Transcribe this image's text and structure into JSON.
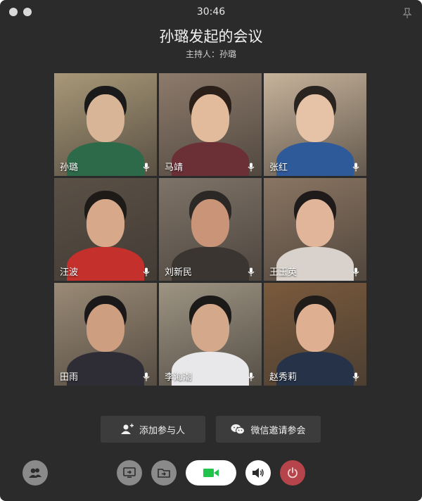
{
  "window": {
    "timer": "30:46"
  },
  "meeting": {
    "title": "孙璐发起的会议",
    "host_label": "主持人：孙璐"
  },
  "participants": [
    {
      "name": "孙璐",
      "bg": "#a89878",
      "skin": "#d8b596",
      "shirt": "#2d6a4a",
      "hair": "#1a1a1a"
    },
    {
      "name": "马靖",
      "bg": "#8d7b6c",
      "skin": "#e1bb9c",
      "shirt": "#6b2f36",
      "hair": "#2a2019"
    },
    {
      "name": "张红",
      "bg": "#c7b39b",
      "skin": "#e6c2a6",
      "shirt": "#2f5a9a",
      "hair": "#2a2420"
    },
    {
      "name": "汪波",
      "bg": "#5a5046",
      "skin": "#d7a98a",
      "shirt": "#c4302c",
      "hair": "#1d1a18"
    },
    {
      "name": "刘新民",
      "bg": "#7e7368",
      "skin": "#c99477",
      "shirt": "#3a3530",
      "hair": "#2b2826"
    },
    {
      "name": "王玉英",
      "bg": "#8a7562",
      "skin": "#e0b59a",
      "shirt": "#d9d2cc",
      "hair": "#1e1b1a"
    },
    {
      "name": "田雨",
      "bg": "#9a8a76",
      "skin": "#cd9f80",
      "shirt": "#2e2d35",
      "hair": "#1a1818"
    },
    {
      "name": "李海潮",
      "bg": "#9d9483",
      "skin": "#d4a88a",
      "shirt": "#e8e8ea",
      "hair": "#1b1a19"
    },
    {
      "name": "赵秀莉",
      "bg": "#7a5a3c",
      "skin": "#deb091",
      "shirt": "#263248",
      "hair": "#201c1a"
    }
  ],
  "actions": {
    "add_participant": "添加参与人",
    "wechat_invite": "微信邀请参会"
  },
  "colors": {
    "window_bg": "#2b2b2b",
    "button_bg": "#3c3c3c",
    "video_green": "#21c44a",
    "hangup_red": "#b5454a"
  }
}
